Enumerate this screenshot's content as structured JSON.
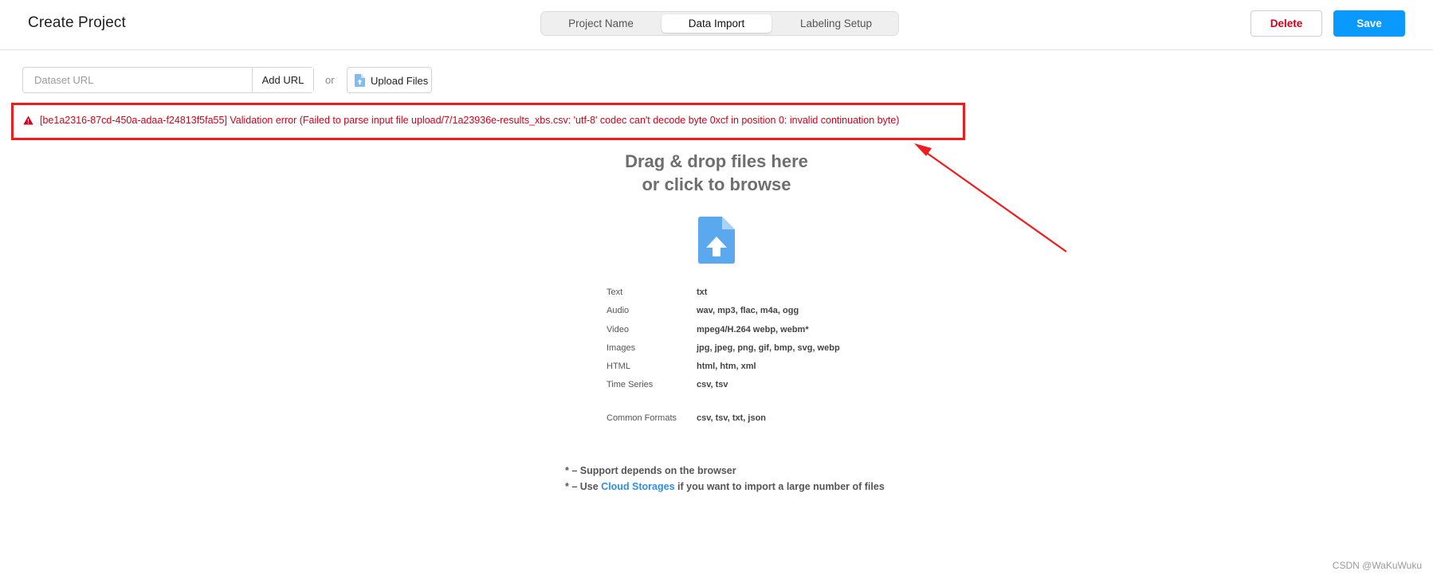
{
  "header": {
    "title": "Create Project",
    "tabs": [
      {
        "label": "Project Name"
      },
      {
        "label": "Data Import"
      },
      {
        "label": "Labeling Setup"
      }
    ],
    "active_tab": "Data Import",
    "delete_label": "Delete",
    "save_label": "Save"
  },
  "import_bar": {
    "url_placeholder": "Dataset URL",
    "add_url_label": "Add URL",
    "or_label": "or",
    "upload_label": "Upload Files"
  },
  "error": {
    "message": "[be1a2316-87cd-450a-adaa-f24813f5fa55] Validation error (Failed to parse input file upload/7/1a23936e-results_xbs.csv: 'utf-8' codec can't decode byte 0xcf in position 0: invalid continuation byte)"
  },
  "dropzone": {
    "title_line1": "Drag & drop files here",
    "title_line2": "or click to browse",
    "icon": "file-upload-icon",
    "formats": [
      {
        "name": "Text",
        "ext": "txt"
      },
      {
        "name": "Audio",
        "ext": "wav, mp3, flac, m4a, ogg"
      },
      {
        "name": "Video",
        "ext": "mpeg4/H.264 webp, webm*"
      },
      {
        "name": "Images",
        "ext": "jpg, jpeg, png, gif, bmp, svg, webp"
      },
      {
        "name": "HTML",
        "ext": "html, htm, xml"
      },
      {
        "name": "Time Series",
        "ext": "csv, tsv"
      }
    ],
    "common": {
      "name": "Common Formats",
      "ext": "csv, tsv, txt, json"
    },
    "note1": "* – Support depends on the browser",
    "note2_prefix": "* – Use ",
    "note2_link": "Cloud Storages",
    "note2_suffix": " if you want to import a large number of files"
  },
  "watermark": "CSDN @WaKuWuku",
  "colors": {
    "accent": "#0a99ff",
    "danger": "#d0021b",
    "error_border": "#f01c1c",
    "file_icon": "#5aa8ee",
    "link": "#2f8fe6"
  }
}
